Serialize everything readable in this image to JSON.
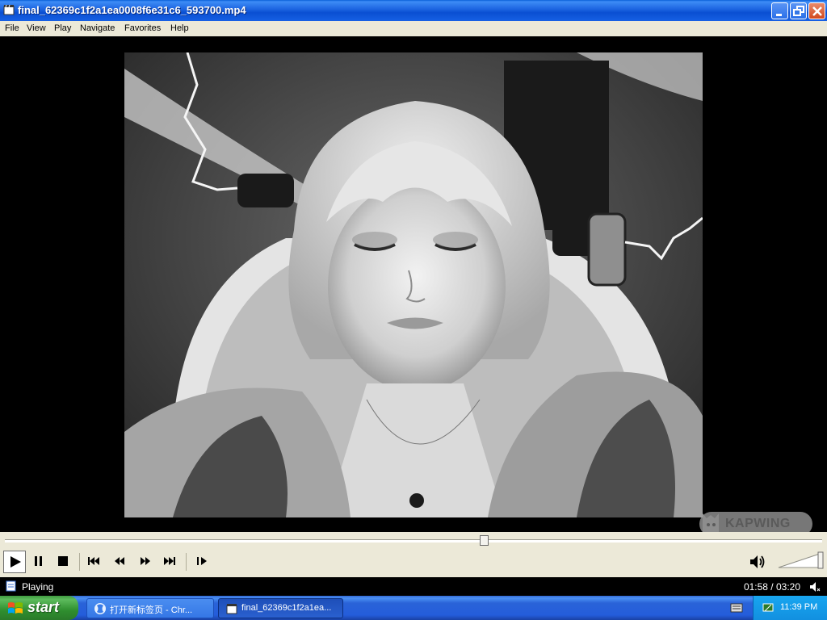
{
  "window": {
    "title": "final_62369c1f2a1ea0008f6e31c6_593700.mp4"
  },
  "menu": [
    "File",
    "View",
    "Play",
    "Navigate",
    "Favorites",
    "Help"
  ],
  "video": {
    "watermark": "KAPWING"
  },
  "playback": {
    "progress": 0.586,
    "volume_level": 1.0
  },
  "controls": {
    "icons": [
      "play-icon",
      "pause-icon",
      "stop-icon",
      "skip-back-icon",
      "rewind-icon",
      "fast-forward-icon",
      "skip-forward-icon",
      "step-frame-icon",
      "volume-icon"
    ]
  },
  "status": {
    "state": "Playing",
    "time": "01:58 / 03:20"
  },
  "taskbar": {
    "start_label": "start",
    "tasks": [
      {
        "label": "打开新标签页 - Chr...",
        "active": false
      },
      {
        "label": "final_62369c1f2a1ea...",
        "active": true
      }
    ],
    "clock": "11:39 PM"
  },
  "colors": {
    "titlebar": "#0a4fd2",
    "chrome": "#ece9d8",
    "start_green": "#3f9a3f",
    "taskbar_blue": "#245ddb",
    "tray_blue": "#1290e0"
  }
}
